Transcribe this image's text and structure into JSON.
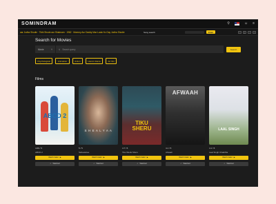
{
  "header": {
    "logo": "SOMINDRAM",
    "icons": [
      "search-icon",
      "flag-icon",
      "user-icon",
      "menu-icon"
    ]
  },
  "ticker": {
    "text": "aar Jodha Shodie · Tikhi Shode aur Shabnam · 1962 · Mommy Aur Daddy Man Lada Ho Gay Jodha Shodie",
    "search_label": "Song search",
    "button_label": "Enter",
    "controls": [
      "<",
      "||",
      ">",
      "≡"
    ]
  },
  "search": {
    "title": "Search for Movies",
    "type_value": "Movie",
    "placeholder": "Search query",
    "button_label": "Search",
    "chips": [
      "Psychological",
      "Animation",
      "Action",
      "Heroic drama",
      "Art film"
    ]
  },
  "films": {
    "heading": "Films",
    "watch_label": "Watch trailer",
    "watched_label": "Watched",
    "items": [
      {
        "rating": "4.69 / 5",
        "title": "ABCD 2",
        "poster_text": "ABCD 2",
        "accent": "#1a6fb0"
      },
      {
        "rating": "5 / 5",
        "title": "Saheelaree",
        "poster_text": "S H E A L Y A A",
        "accent": "#e9e9e9"
      },
      {
        "rating": "4.7 / 5",
        "title": "Tiku Weds Sheru",
        "poster_text": "TIKU SHERU",
        "accent": "#f1c40f"
      },
      {
        "rating": "4.1 / 5",
        "title": "Afwaah",
        "poster_text": "AFWAAH",
        "accent": "#e23b2e"
      },
      {
        "rating": "4.1 / 5",
        "title": "Laal Singh Chaddha",
        "poster_text": "LAAL SINGH",
        "accent": "#ffffff"
      }
    ]
  }
}
